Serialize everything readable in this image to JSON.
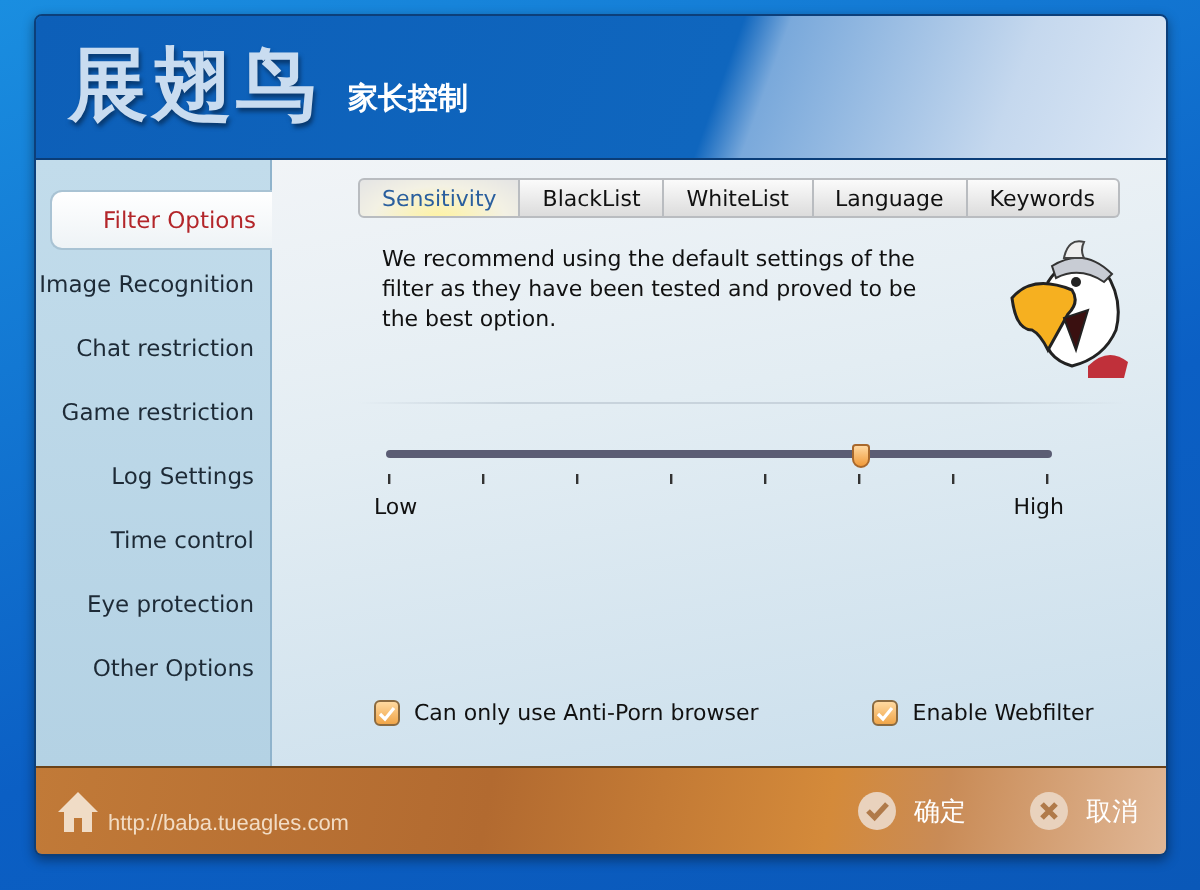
{
  "header": {
    "logo": "展翅鸟",
    "subtitle": "家长控制"
  },
  "sidebar": {
    "items": [
      {
        "label": "Filter Options",
        "selected": true
      },
      {
        "label": "Image Recognition",
        "selected": false
      },
      {
        "label": "Chat restriction",
        "selected": false
      },
      {
        "label": "Game restriction",
        "selected": false
      },
      {
        "label": "Log Settings",
        "selected": false
      },
      {
        "label": "Time control",
        "selected": false
      },
      {
        "label": "Eye protection",
        "selected": false
      },
      {
        "label": "Other Options",
        "selected": false
      }
    ]
  },
  "tabs": [
    {
      "label": "Sensitivity",
      "selected": true
    },
    {
      "label": "BlackList",
      "selected": false
    },
    {
      "label": "WhiteList",
      "selected": false
    },
    {
      "label": "Language",
      "selected": false
    },
    {
      "label": "Keywords",
      "selected": false
    }
  ],
  "description": "We recommend using the default settings of the filter as they have been tested and proved to be the best option.",
  "slider": {
    "level": 0.714,
    "min_label": "Low",
    "max_label": "High"
  },
  "checkboxes": [
    {
      "label": "Can only use Anti-Porn browser",
      "checked": true
    },
    {
      "label": "Enable Webfilter",
      "checked": true
    }
  ],
  "footer": {
    "url": "http://baba.tueagles.com",
    "buttons": [
      {
        "kind": "ok",
        "label": "确定"
      },
      {
        "kind": "cancel",
        "label": "取消"
      }
    ]
  }
}
